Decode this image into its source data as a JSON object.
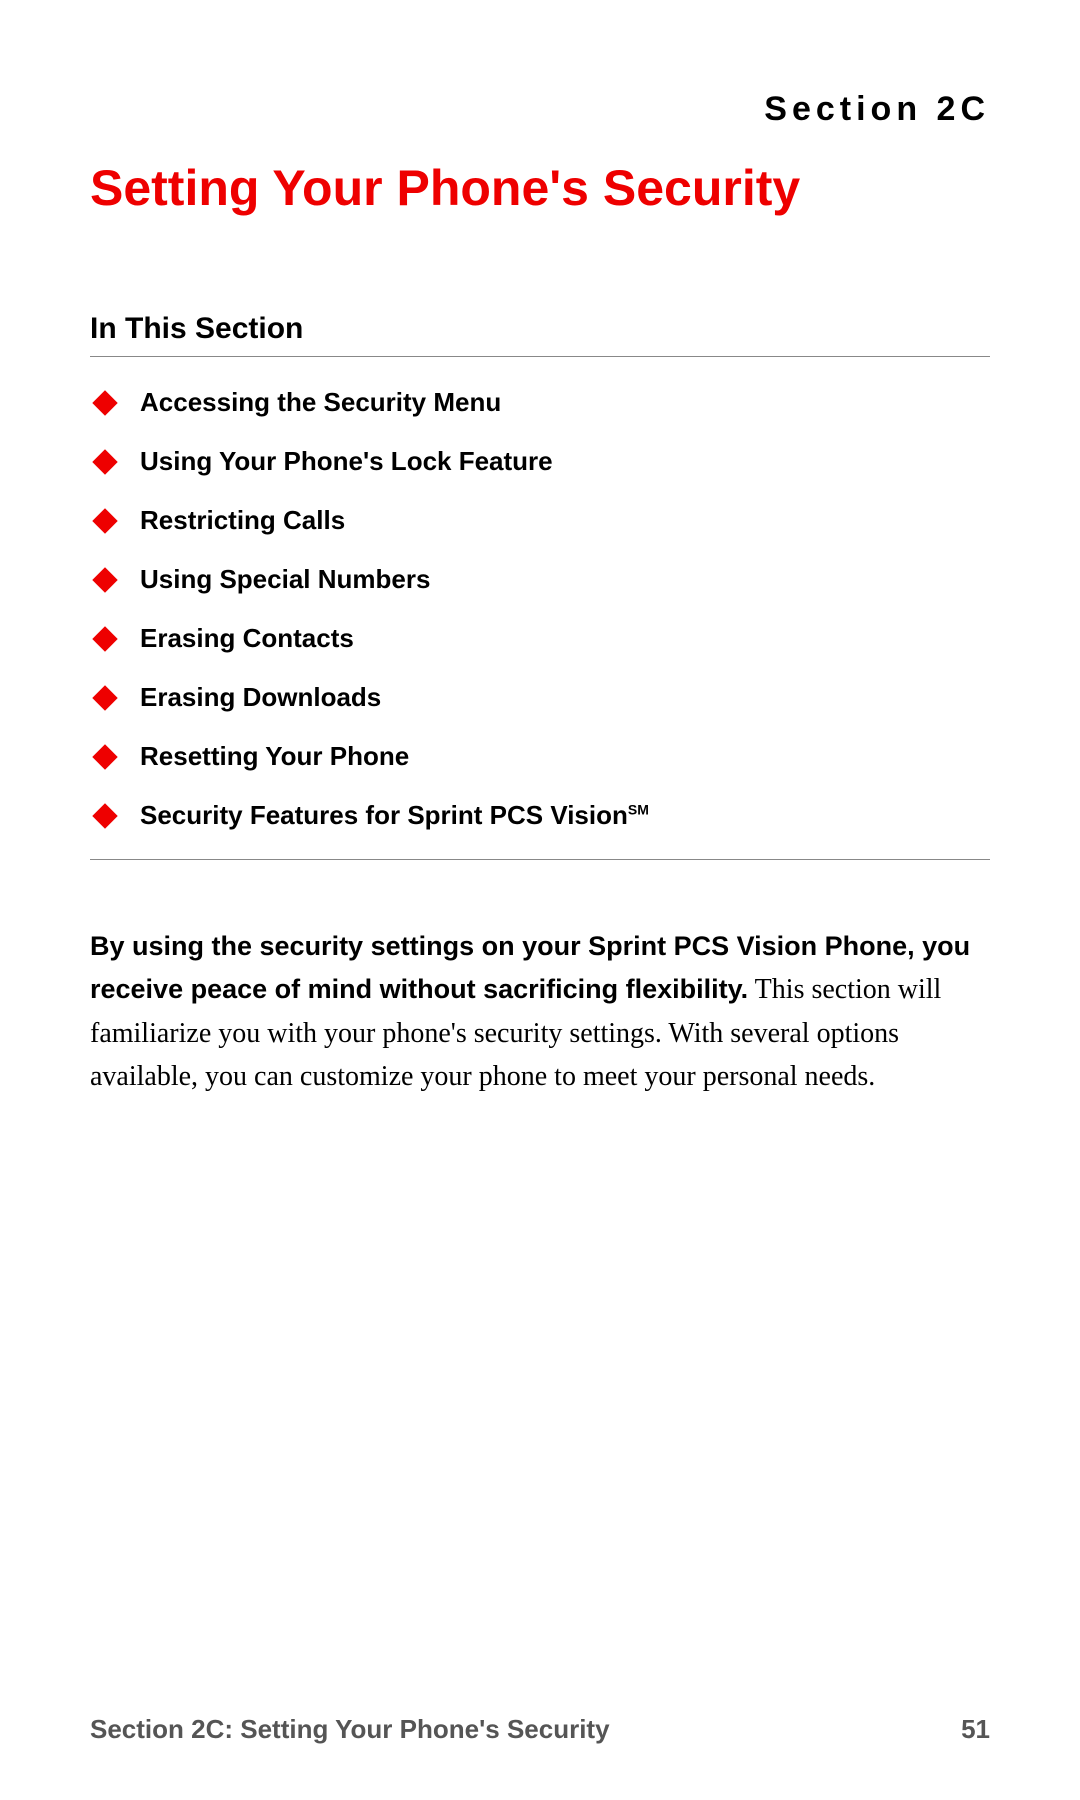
{
  "header": {
    "section_label": "Section 2C",
    "page_title": "Setting Your Phone's Security"
  },
  "subsection": {
    "title": "In This Section",
    "items": [
      "Accessing the Security Menu",
      "Using Your Phone's Lock Feature",
      "Restricting Calls",
      "Using Special Numbers",
      "Erasing Contacts",
      "Erasing Downloads",
      "Resetting Your Phone",
      "Security Features for Sprint PCS Vision"
    ],
    "sm_mark": "SM"
  },
  "body": {
    "bold_intro": "By using the security settings on your Sprint PCS Vision Phone, you receive peace of mind without sacrificing flexibility.",
    "rest": " This section will familiarize you with your phone's security settings. With several options available, you can customize your phone to meet your personal needs."
  },
  "footer": {
    "left": "Section 2C: Setting Your Phone's Security",
    "right": "51"
  }
}
